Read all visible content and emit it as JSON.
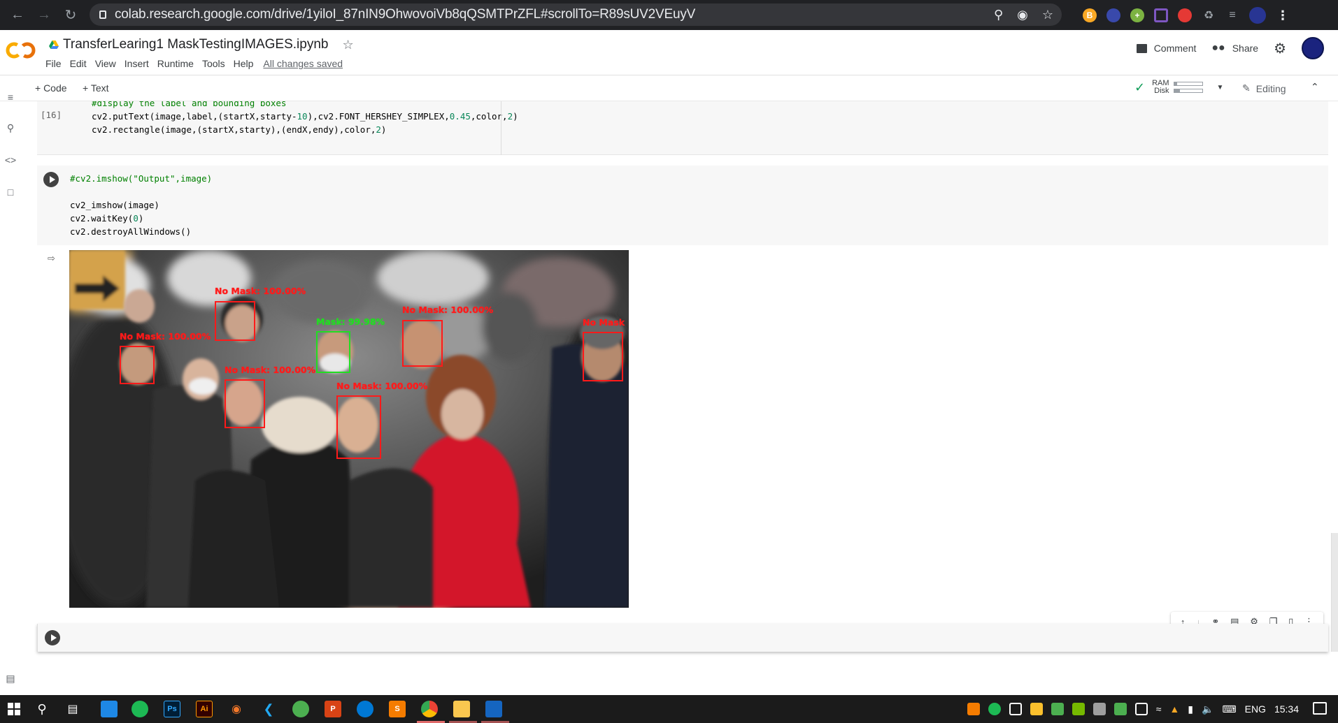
{
  "browser": {
    "url": "colab.research.google.com/drive/1yiloI_87nIN9OhwovoiVb8qQSMTPrZFL#scrollTo=R89sUV2VEuyV"
  },
  "colab": {
    "notebook_name": "TransferLearing1 MaskTestingIMAGES.ipynb",
    "menu": [
      "File",
      "Edit",
      "View",
      "Insert",
      "Runtime",
      "Tools",
      "Help"
    ],
    "save_status": "All changes saved",
    "comment_label": "Comment",
    "share_label": "Share",
    "add_code_label": "+ Code",
    "add_text_label": "+ Text",
    "ram_label": "RAM",
    "disk_label": "Disk",
    "ram_fraction": 0.1,
    "disk_fraction": 0.2,
    "editing_label": "Editing"
  },
  "cells": {
    "prev": {
      "exec_count": "[16]",
      "lines": [
        "#display the label and bounding boxes",
        "cv2.putText(image,label,(startX,starty-10),cv2.FONT_HERSHEY_SIMPLEX,0.45,color,2)",
        "cv2.rectangle(image,(startX,starty),(endX,endy),color,2)"
      ]
    },
    "run": {
      "lines": [
        "#cv2.imshow(\"Output\",image)",
        "",
        "cv2_imshow(image)",
        "cv2.waitKey(0)",
        "cv2.destroyAllWindows()"
      ]
    }
  },
  "detections": [
    {
      "label": "No Mask: 100.00%",
      "color": "#ff1a1a"
    },
    {
      "label": "No Mask: 100.00%",
      "color": "#ff1a1a"
    },
    {
      "label": "Mask: 99.98%",
      "color": "#22dd22"
    },
    {
      "label": "No Mask: 100.00%",
      "color": "#ff1a1a"
    },
    {
      "label": "No Mask",
      "color": "#ff1a1a"
    },
    {
      "label": "No Mask: 100.00%",
      "color": "#ff1a1a"
    },
    {
      "label": "No Mask: 100.00%",
      "color": "#ff1a1a"
    }
  ],
  "taskbar": {
    "lang": "ENG",
    "time": "15:34"
  }
}
